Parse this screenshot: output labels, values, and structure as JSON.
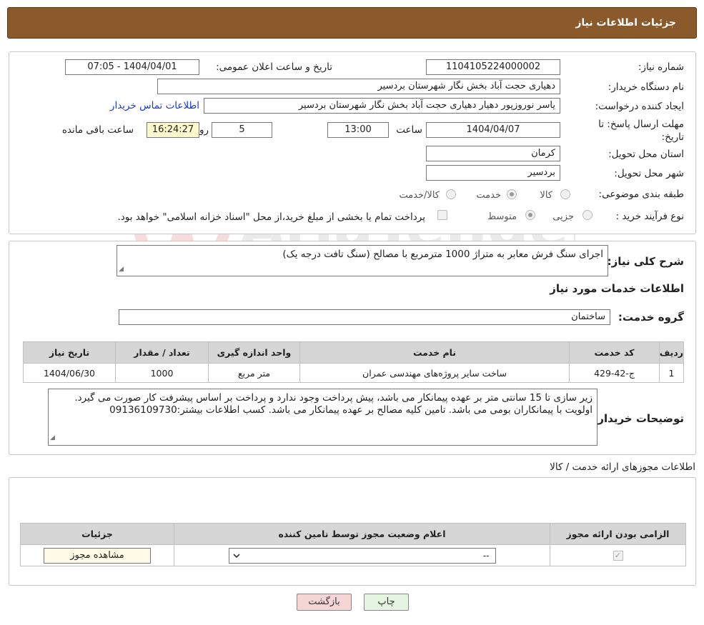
{
  "header": {
    "title": "جزئیات اطلاعات نیاز"
  },
  "form": {
    "need_number": {
      "label": "شماره نیاز:",
      "value": "1104105224000002"
    },
    "announce_datetime": {
      "label": "تاریخ و ساعت اعلان عمومی:",
      "value": "1404/04/01 - 07:05"
    },
    "buyer_org": {
      "label": "نام دستگاه خریدار:",
      "value": "دهیاری حجت آباد بخش نگار شهرستان بردسیر"
    },
    "requester": {
      "label": "ایجاد کننده درخواست:",
      "value": "یاسر نوروزپور دهیار دهیاری حجت آباد بخش نگار شهرستان بردسیر",
      "contact_link": "اطلاعات تماس خریدار"
    },
    "deadline": {
      "label": "مهلت ارسال پاسخ: تا تاریخ:",
      "date": "1404/04/07",
      "time_label": "ساعت",
      "time": "13:00",
      "days": "5",
      "days_label": "روز و",
      "remaining": "16:24:27",
      "remaining_label": "ساعت باقی مانده"
    },
    "province": {
      "label": "استان محل تحویل:",
      "value": "کرمان"
    },
    "city": {
      "label": "شهر محل تحویل:",
      "value": "بردسیر"
    },
    "category": {
      "label": "طبقه بندی موضوعی:",
      "options": [
        "کالا",
        "خدمت",
        "کالا/خدمت"
      ],
      "selected": "خدمت"
    },
    "purchase_type": {
      "label": "نوع فرآیند خرید :",
      "options": [
        "جزیی",
        "متوسط"
      ],
      "selected": "متوسط",
      "note": "پرداخت تمام یا بخشی از مبلغ خرید،از محل \"اسناد خزانه اسلامی\" خواهد بود."
    }
  },
  "description": {
    "label": "شرح کلی نیاز:",
    "value": "اجرای سنگ فرش معابر به متراژ 1000 مترمربع با مصالح (سنگ تافت درجه یک)"
  },
  "services": {
    "section_title": "اطلاعات خدمات مورد نیاز",
    "group_label": "گروه خدمت:",
    "group_value": "ساختمان",
    "columns": [
      "ردیف",
      "کد خدمت",
      "نام خدمت",
      "واحد اندازه گیری",
      "تعداد / مقدار",
      "تاریخ نیاز"
    ],
    "rows": [
      [
        "1",
        "ج-42-429",
        "ساخت سایر پروژه‌های مهندسی عمران",
        "متر مربع",
        "1000",
        "1404/06/30"
      ]
    ]
  },
  "buyer_notes": {
    "label": "توضیحات خریدار:",
    "value": "زیر سازی تا 15 سانتی متر بر عهده پیمانکار می باشد، پیش پرداخت وجود ندارد و پرداخت بر اساس پیشرفت کار صورت می گیرد. اولویت با پیمانکاران بومی می باشد. تامین کلیه مصالح بر عهده پیمانکار می باشد. کسب اطلاعات بیشتر:09136109730"
  },
  "permits": {
    "section_title": "اطلاعات مجوزهای ارائه خدمت / کالا",
    "columns": [
      "الزامی بودن ارائه مجوز",
      "اعلام وضعیت مجوز توسط تامین کننده",
      "جزئیات"
    ],
    "row": {
      "select_value": "--",
      "view_button": "مشاهده مجوز"
    }
  },
  "actions": {
    "print": "چاپ",
    "back": "بازگشت"
  },
  "watermark": {
    "text": "AriaTender.neT"
  },
  "colors": {
    "header_bg": "#8b5a2b",
    "link": "#1a3dc7",
    "back_button_bg": "#f6d5d5",
    "print_button_bg": "#e6f4e2"
  }
}
